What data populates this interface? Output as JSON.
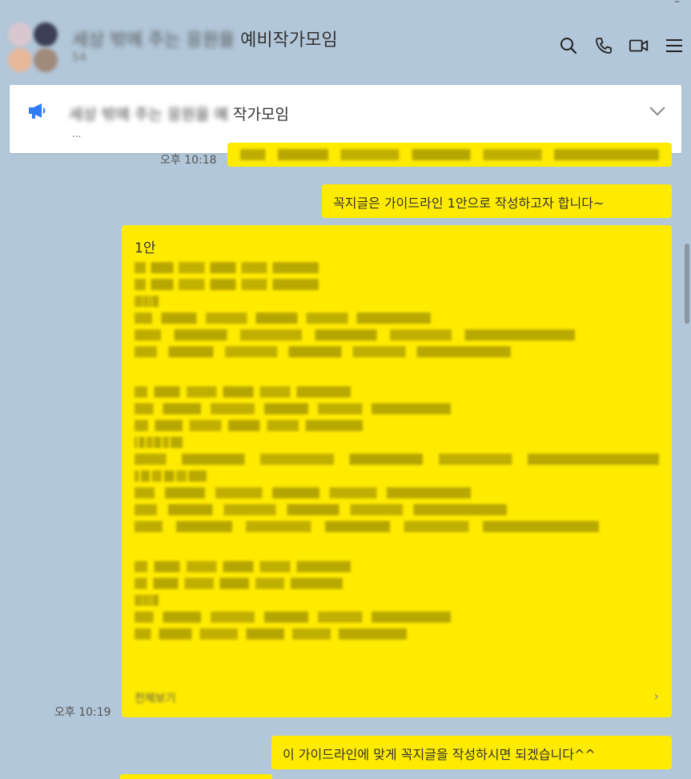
{
  "header": {
    "room_name_blurred": "세상 밖에 주는 응원을",
    "room_name_suffix": "예비작가모임",
    "member_count": "54",
    "icons": [
      "search-icon",
      "phone-icon",
      "video-icon",
      "menu-icon"
    ]
  },
  "notice": {
    "title_blurred": "세상 밖에 주는 응원을 예",
    "title_suffix": "작가모임",
    "dots": "...",
    "icon": "megaphone-icon",
    "chevron": "chevron-down-icon"
  },
  "messages": [
    {
      "id": "m0",
      "time": "오후 10:18",
      "text_blurred": "가이드라인 안내 드립니다 참고해주세요"
    },
    {
      "id": "m1",
      "time": "",
      "text": "꼭지글은 가이드라인 1안으로 작성하고자 합니다~"
    },
    {
      "id": "m2",
      "time": "오후 10:19",
      "head": "1안",
      "more_label": "전체보기",
      "more_arrow": "›"
    },
    {
      "id": "m3",
      "time": "",
      "text": "이 가이드라인에 맞게 꼭지글을 작성하시면 되겠습니다^^"
    }
  ],
  "colors": {
    "background": "#b2c7d9",
    "bubble": "#ffeb00",
    "notice_bg": "#ffffff",
    "megaphone": "#2f7cf6"
  }
}
